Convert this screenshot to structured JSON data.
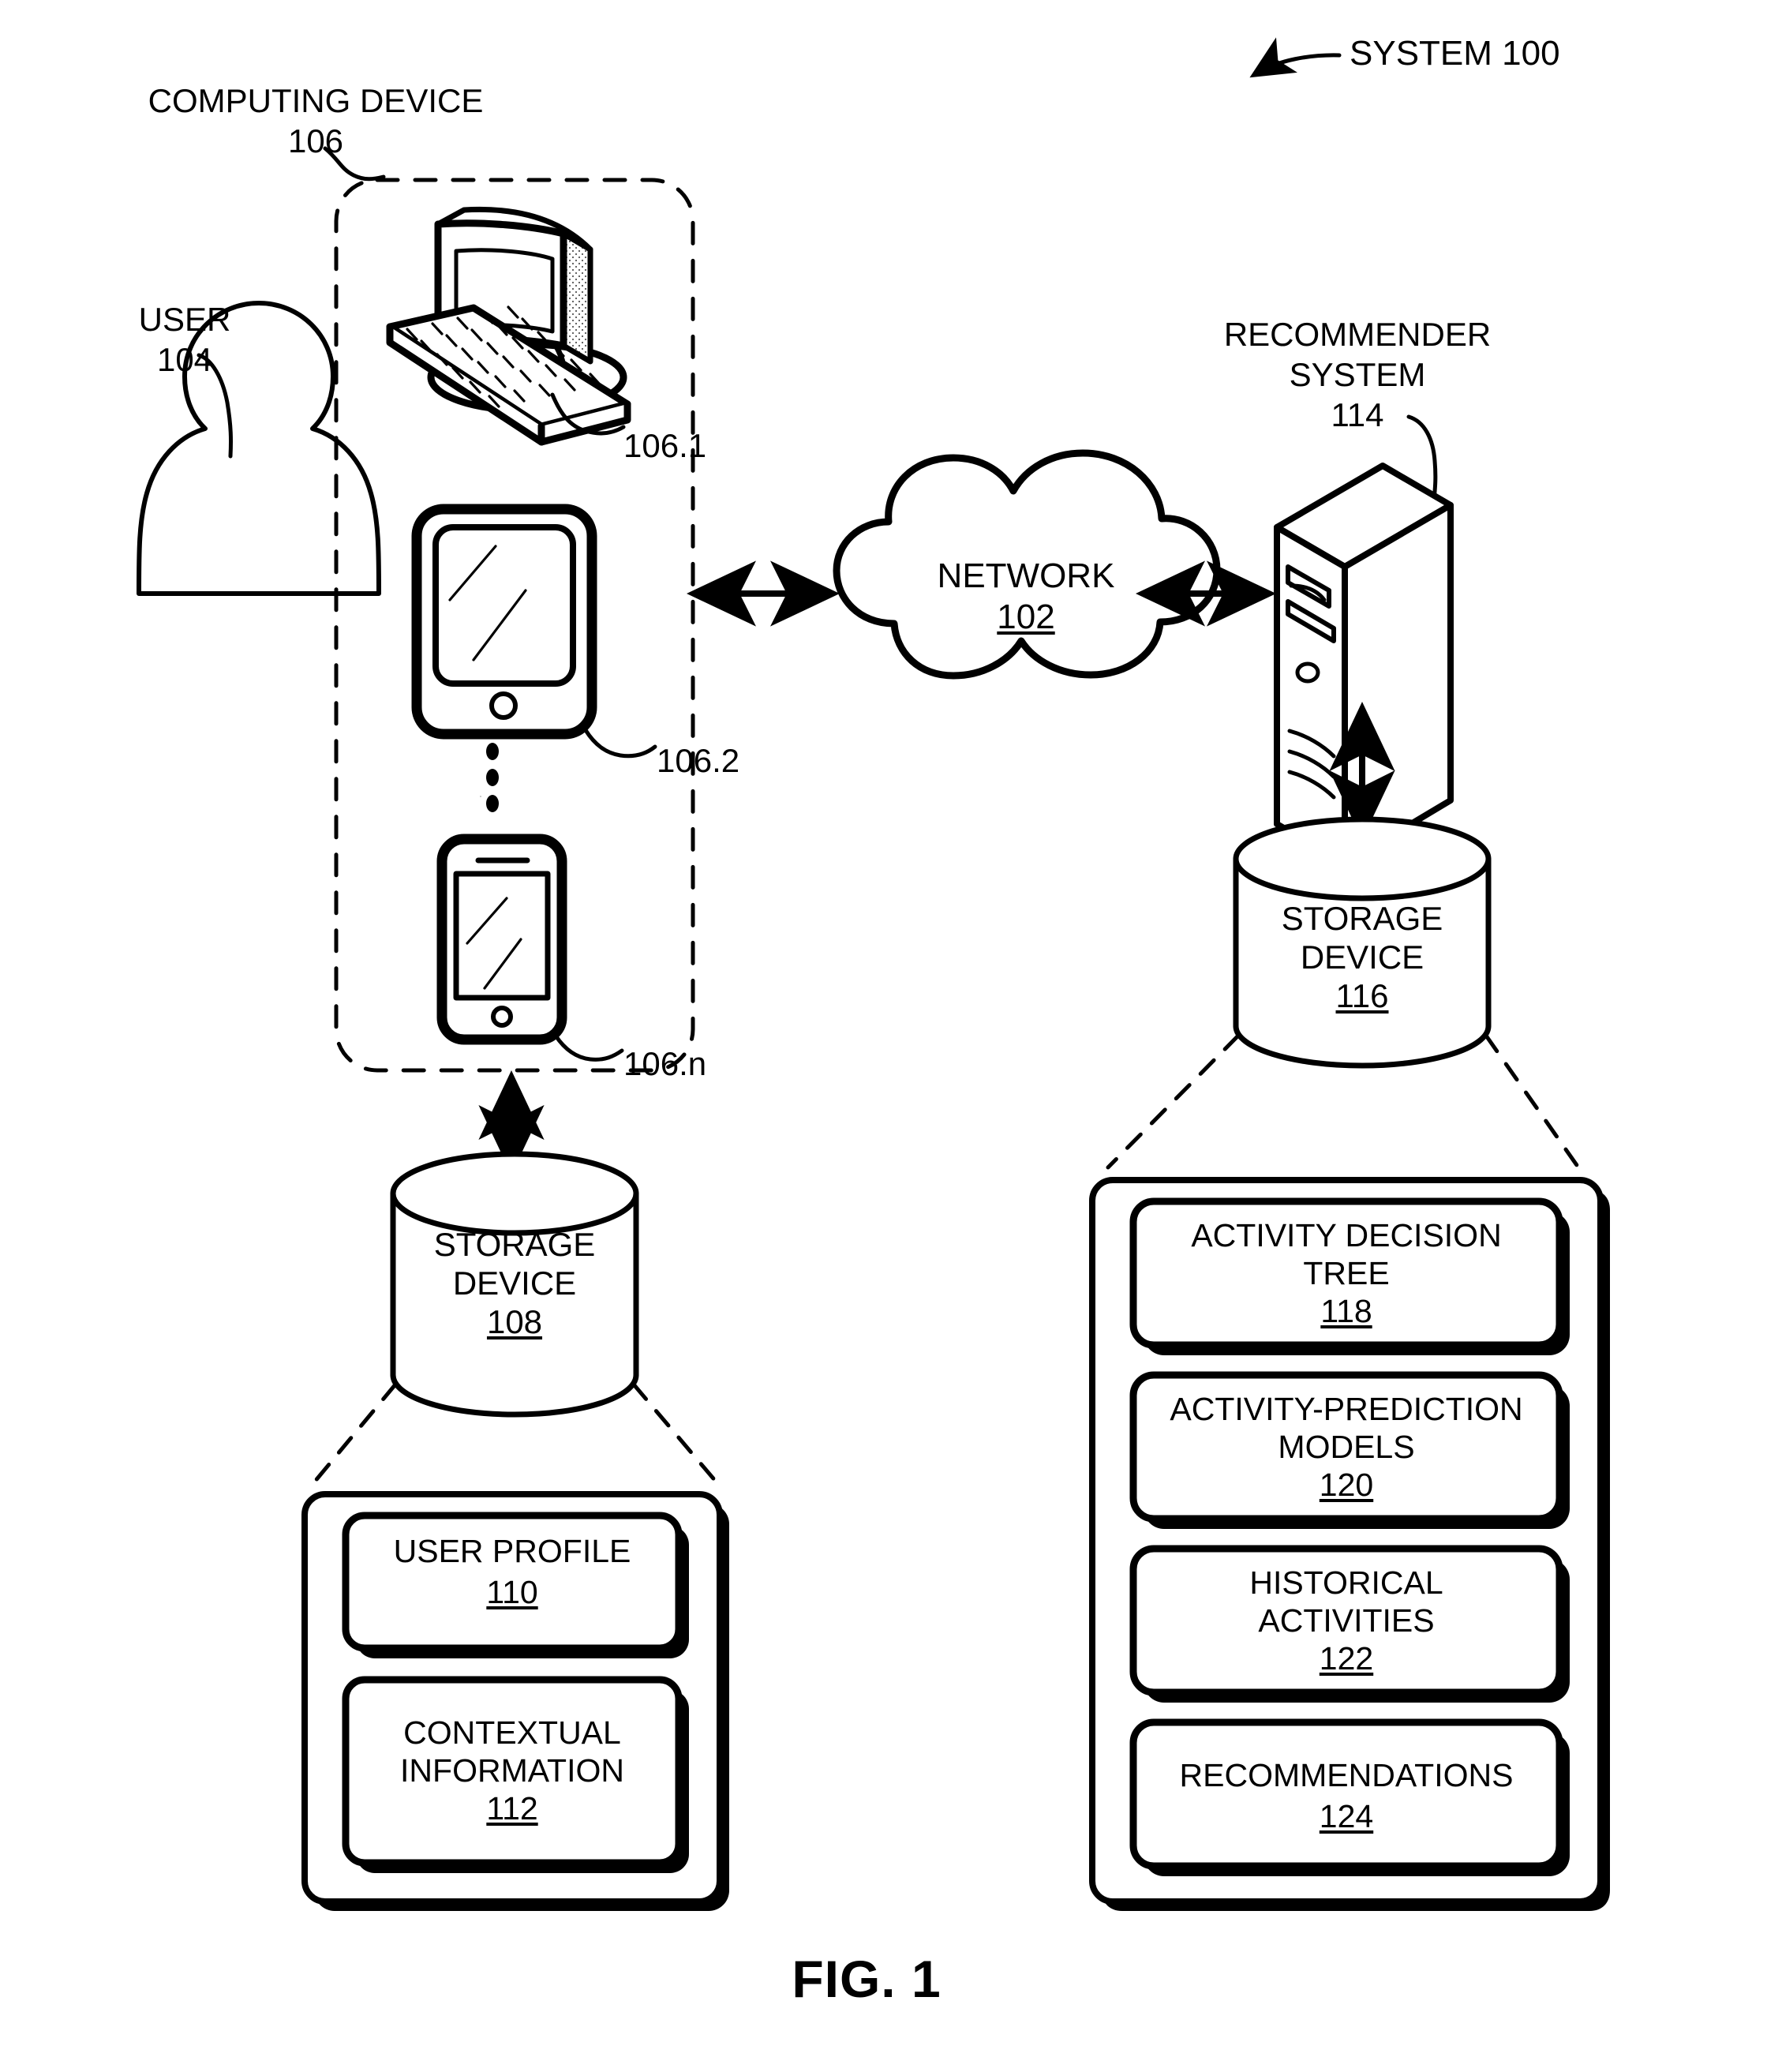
{
  "figure": {
    "caption": "FIG. 1",
    "system_label": "SYSTEM 100"
  },
  "user": {
    "label_line1": "USER",
    "label_line2": "104",
    "icon": "user-person-icon"
  },
  "computing_device_group": {
    "label_line1": "COMPUTING DEVICE",
    "label_line2": "106",
    "devices": [
      {
        "icon": "desktop-computer-icon",
        "ref": "106.1"
      },
      {
        "icon": "tablet-icon",
        "ref": "106.2"
      },
      {
        "icon": "smartphone-icon",
        "ref": "106.n"
      }
    ],
    "ellipsis": "vertical-ellipsis-icon"
  },
  "network": {
    "name": "NETWORK",
    "ref": "102",
    "icon": "cloud-icon"
  },
  "recommender_system": {
    "label_line1": "RECOMMENDER",
    "label_line2": "SYSTEM",
    "label_line3": "114",
    "icon": "server-tower-icon"
  },
  "client_storage": {
    "name_line1": "STORAGE",
    "name_line2": "DEVICE",
    "ref": "108",
    "icon": "database-cylinder-icon",
    "contents": [
      {
        "title_line1": "USER PROFILE",
        "title_line2": "",
        "ref": "110"
      },
      {
        "title_line1": "CONTEXTUAL",
        "title_line2": "INFORMATION",
        "ref": "112"
      }
    ]
  },
  "server_storage": {
    "name_line1": "STORAGE",
    "name_line2": "DEVICE",
    "ref": "116",
    "icon": "database-cylinder-icon",
    "contents": [
      {
        "title_line1": "ACTIVITY DECISION",
        "title_line2": "TREE",
        "ref": "118"
      },
      {
        "title_line1": "ACTIVITY-PREDICTION",
        "title_line2": "MODELS",
        "ref": "120"
      },
      {
        "title_line1": "HISTORICAL",
        "title_line2": "ACTIVITIES",
        "ref": "122"
      },
      {
        "title_line1": "RECOMMENDATIONS",
        "title_line2": "",
        "ref": "124"
      }
    ]
  },
  "colors": {
    "ink": "#000000",
    "paper": "#ffffff"
  }
}
